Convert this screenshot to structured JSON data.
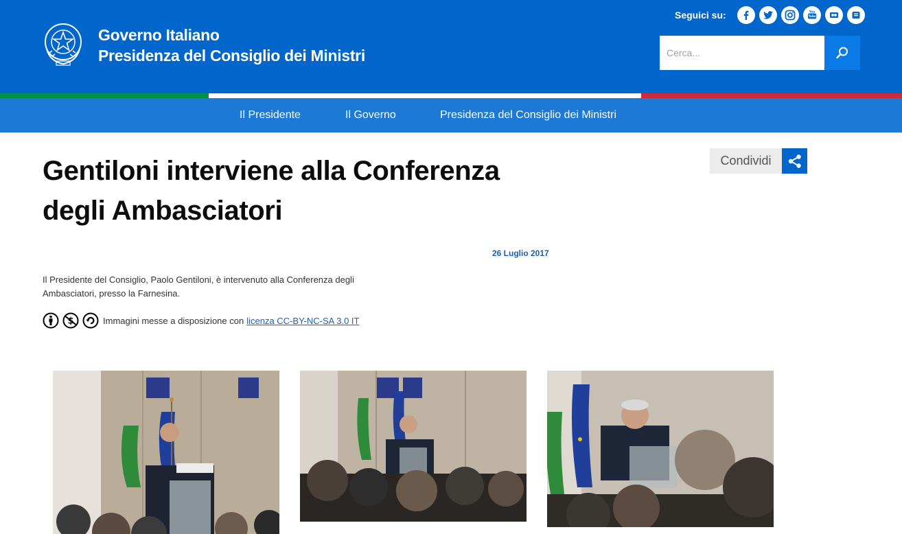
{
  "header": {
    "brand_line1": "Governo Italiano",
    "brand_line2": "Presidenza del Consiglio dei Ministri",
    "follow_label": "Seguici su:",
    "social": [
      "facebook-icon",
      "twitter-icon",
      "instagram-icon",
      "youtube-icon",
      "flickr-icon",
      "storify-icon"
    ],
    "search_placeholder": "Cerca..."
  },
  "nav": {
    "items": [
      "Il Presidente",
      "Il Governo",
      "Presidenza del Consiglio dei Ministri"
    ]
  },
  "article": {
    "title": "Gentiloni interviene alla Conferenza degli Ambasciatori",
    "share_label": "Condividi",
    "date": "26 Luglio 2017",
    "intro": "Il Presidente del Consiglio, Paolo Gentiloni, è intervenuto alla Conferenza degli Ambasciatori, presso la Farnesina.",
    "license_text": "Immagini messe a disposizione con",
    "license_link": "licenza CC-BY-NC-SA 3.0 IT"
  },
  "colors": {
    "header_blue": "#0066cc",
    "nav_blue": "#1c7ad6",
    "flag_green": "#009246",
    "flag_red": "#ce2b37"
  }
}
